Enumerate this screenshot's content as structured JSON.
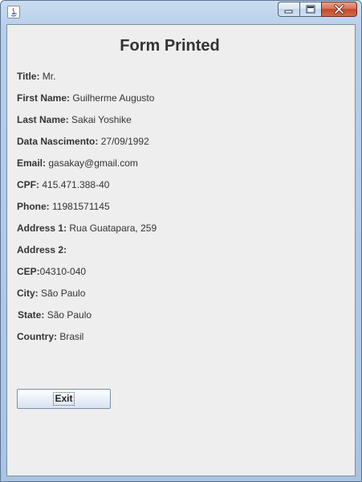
{
  "window": {
    "title": "",
    "icon": "java-icon",
    "controls": {
      "minimize": "minimize-icon",
      "maximize": "maximize-icon",
      "close": "close-icon"
    }
  },
  "form": {
    "heading": "Form Printed",
    "fields": [
      {
        "label": "Title:",
        "value": "Mr."
      },
      {
        "label": "First Name:",
        "value": "Guilherme Augusto"
      },
      {
        "label": "Last Name:",
        "value": "Sakai Yoshike"
      },
      {
        "label": "Data Nascimento:",
        "value": "27/09/1992"
      },
      {
        "label": "Email:",
        "value": "gasakay@gmail.com"
      },
      {
        "label": "CPF:",
        "value": "415.471.388-40"
      },
      {
        "label": "Phone:",
        "value": "11981571145"
      },
      {
        "label": "Address 1:",
        "value": "Rua Guatapara, 259"
      },
      {
        "label": "Address 2:",
        "value": ""
      },
      {
        "label": "CEP:",
        "value": "04310-040"
      },
      {
        "label": "City:",
        "value": "São Paulo"
      },
      {
        "label": "State:",
        "value": "São Paulo"
      },
      {
        "label": "Country:",
        "value": "Brasil"
      }
    ],
    "exit_label": "Exit"
  }
}
